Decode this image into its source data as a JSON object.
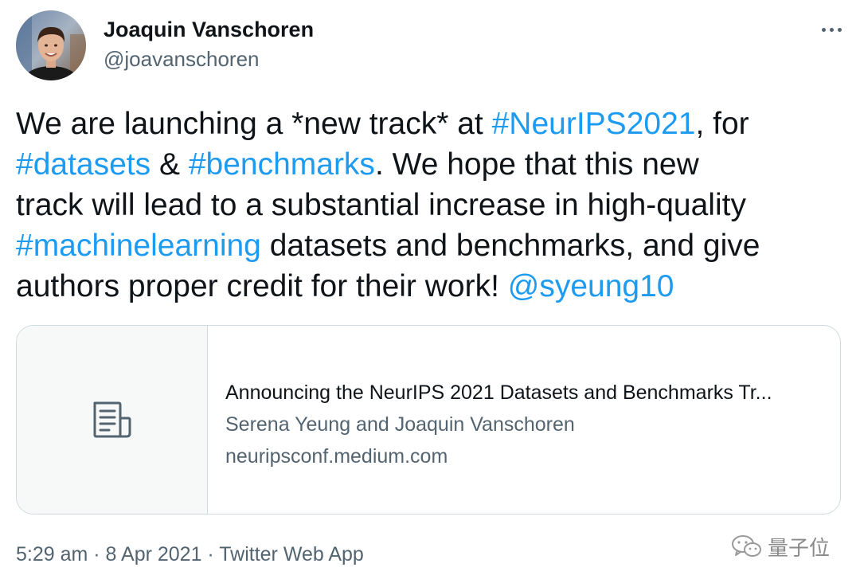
{
  "tweet": {
    "author": {
      "name": "Joaquin Vanschoren",
      "handle": "@joavanschoren"
    },
    "text": {
      "l1_a": "We are launching a *new track* at ",
      "l1_tag": "#NeurIPS2021",
      "l1_b": ", for",
      "l2_tag1": "#datasets",
      "l2_a": " & ",
      "l2_tag2": "#benchmarks",
      "l2_b": ". We hope that this new",
      "l3": "track will lead to a substantial increase in high-quality",
      "l4_tag": "#machinelearning",
      "l4_b": " datasets and benchmarks, and give",
      "l5_a": "authors proper credit for their work! ",
      "l5_mention": "@syeung10"
    },
    "card": {
      "title": "Announcing the NeurIPS 2021 Datasets and Benchmarks Tr...",
      "authors": "Serena Yeung and Joaquin Vanschoren",
      "domain": "neuripsconf.medium.com",
      "icon": "document-icon"
    },
    "meta": "5:29 am · 8 Apr 2021 · Twitter Web App"
  },
  "watermark": {
    "text": "量子位",
    "icon": "wechat-icon"
  },
  "colors": {
    "link": "#1d9bf0",
    "text": "#0f1419",
    "secondary": "#536471",
    "border": "#cfd9de"
  }
}
